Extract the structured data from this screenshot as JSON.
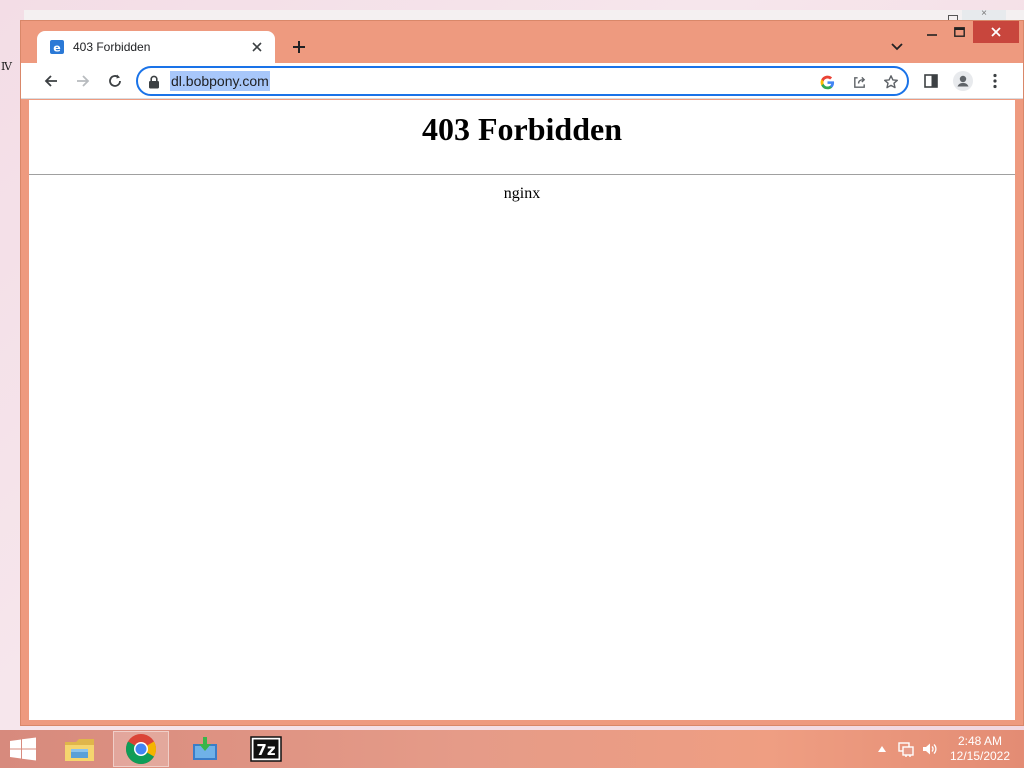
{
  "browser": {
    "tab": {
      "title": "403 Forbidden"
    },
    "omnibox": {
      "url": "dl.bobpony.com"
    },
    "colors": {
      "frame": "#ee9a7f",
      "accent": "#1a73e8",
      "close": "#c8463d"
    }
  },
  "page": {
    "heading": "403 Forbidden",
    "server": "nginx"
  },
  "taskbar": {
    "apps": [
      {
        "name": "File Explorer",
        "icon": "file-explorer-icon"
      },
      {
        "name": "Google Chrome",
        "icon": "chrome-icon",
        "active": true
      },
      {
        "name": "Downloader",
        "icon": "download-app-icon"
      },
      {
        "name": "7-Zip",
        "icon": "7zip-icon",
        "label": "7z"
      }
    ],
    "clock": {
      "time": "2:48 AM",
      "date": "12/15/2022"
    }
  }
}
